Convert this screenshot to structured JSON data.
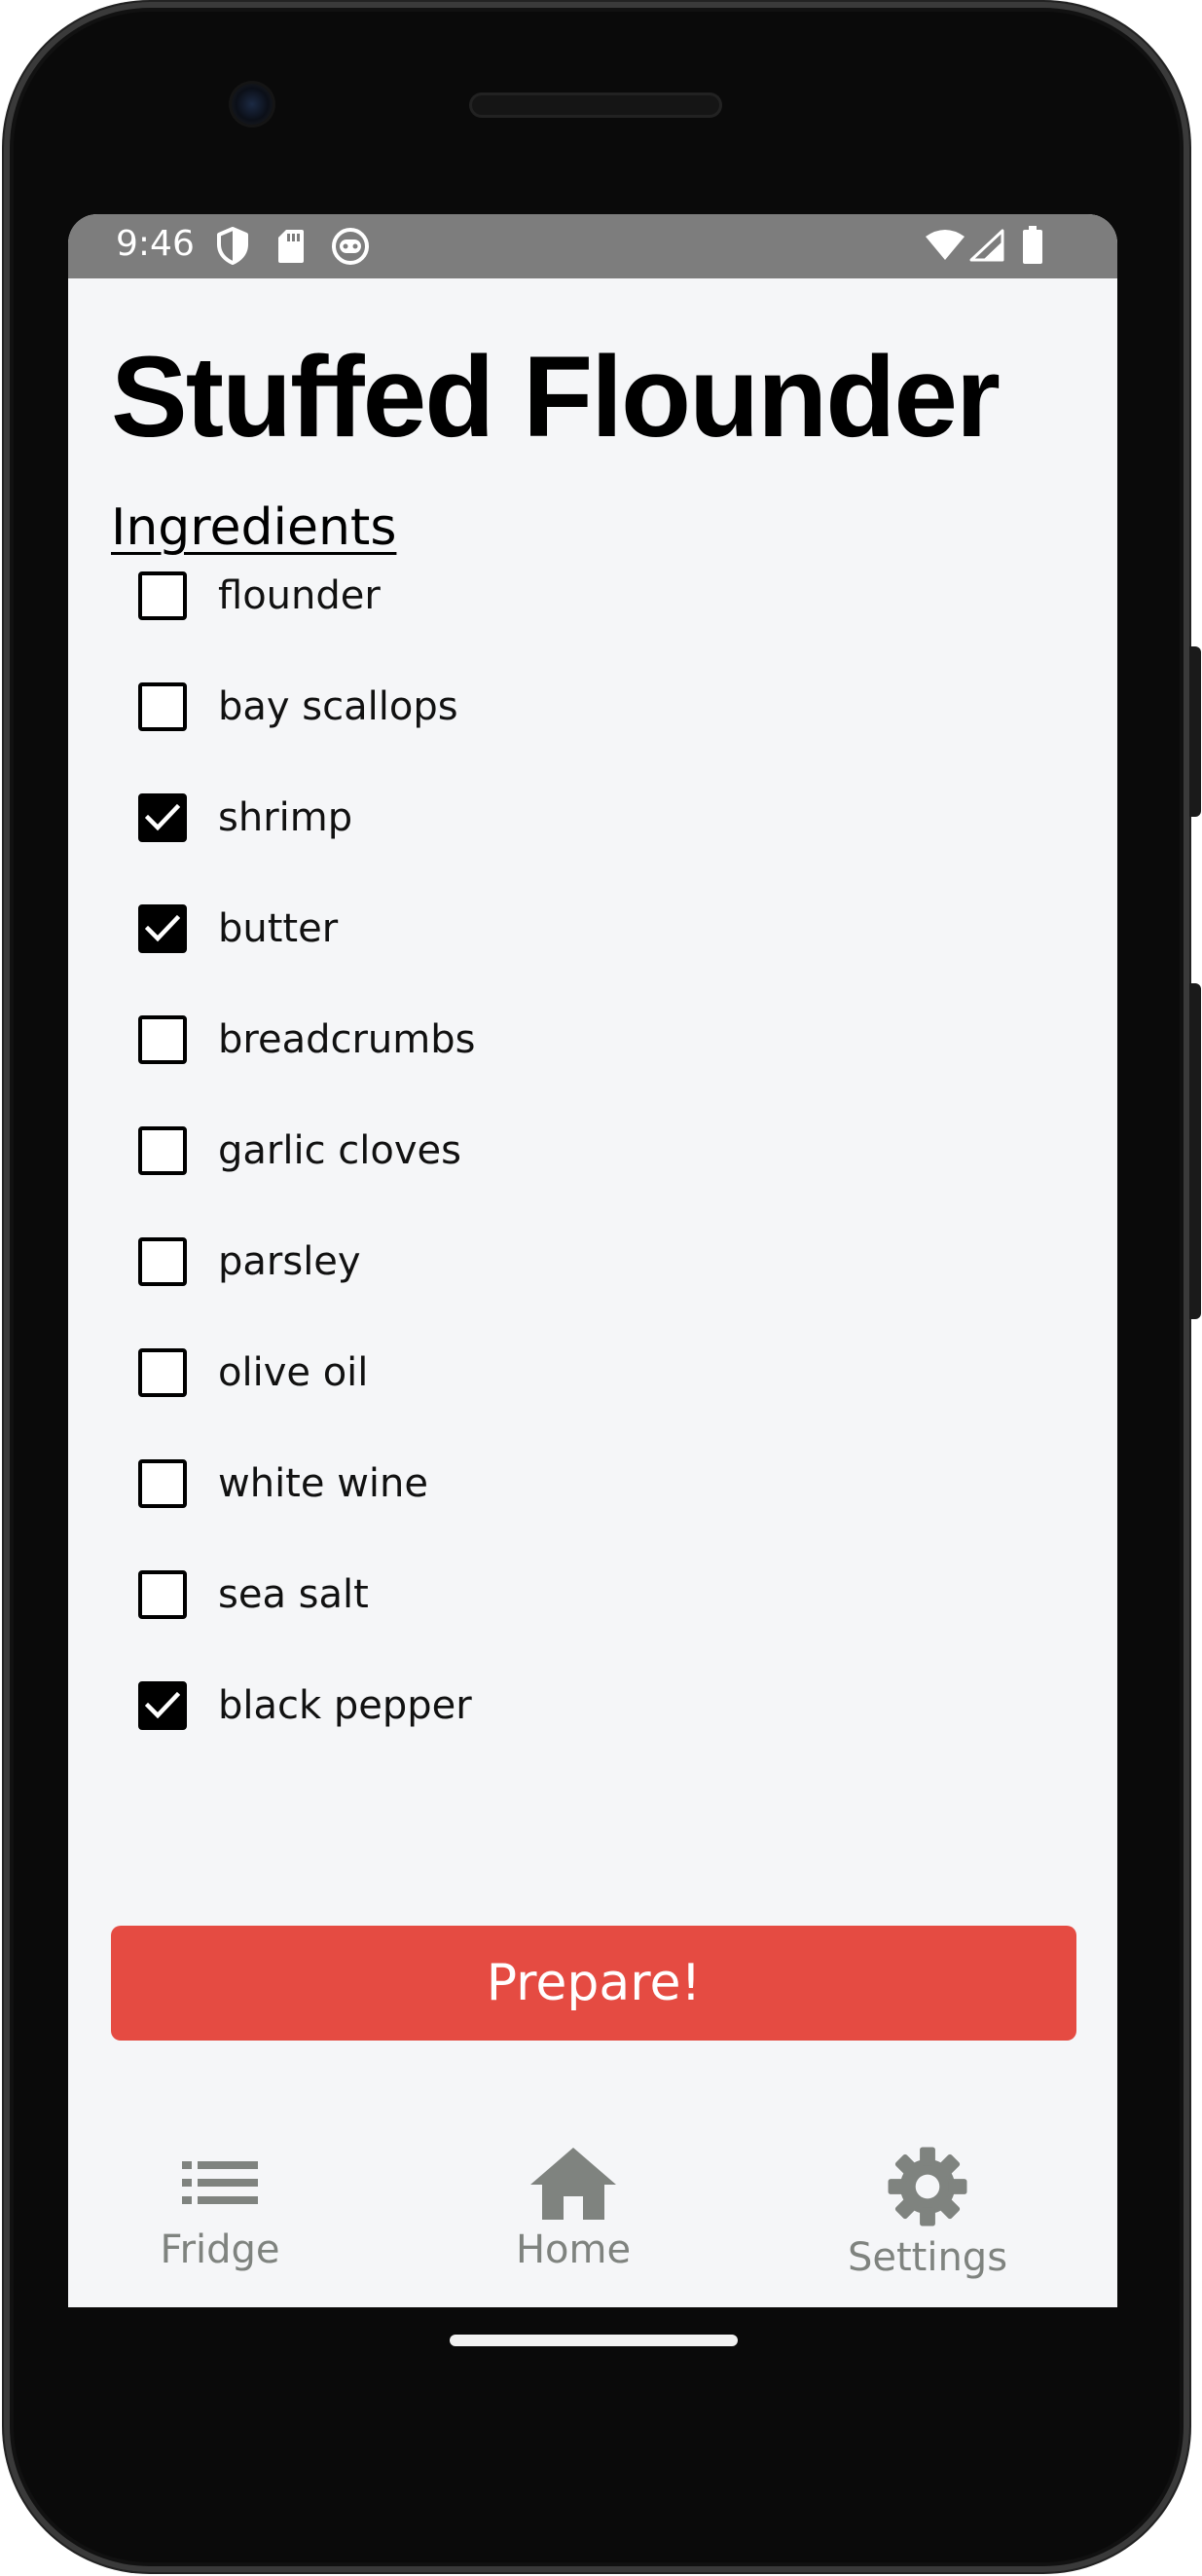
{
  "status_bar": {
    "time": "9:46",
    "left_icons": [
      "shield-icon",
      "sd-card-icon",
      "android-face-icon"
    ],
    "right_icons": [
      "wifi-icon",
      "cell-signal-icon",
      "battery-icon"
    ],
    "background": "#7d7d7d"
  },
  "recipe": {
    "title": "Stuffed Flounder",
    "section_heading": "Ingredients",
    "ingredients": [
      {
        "label": "flounder",
        "checked": false
      },
      {
        "label": "bay scallops",
        "checked": false
      },
      {
        "label": "shrimp",
        "checked": true
      },
      {
        "label": "butter",
        "checked": true
      },
      {
        "label": "breadcrumbs",
        "checked": false
      },
      {
        "label": "garlic cloves",
        "checked": false
      },
      {
        "label": "parsley",
        "checked": false
      },
      {
        "label": "olive oil",
        "checked": false
      },
      {
        "label": "white wine",
        "checked": false
      },
      {
        "label": "sea salt",
        "checked": false
      },
      {
        "label": "black pepper",
        "checked": true
      }
    ],
    "action_button": "Prepare!",
    "action_color": "#e54b42"
  },
  "bottom_nav": {
    "items": [
      {
        "label": "Fridge",
        "icon": "list-icon"
      },
      {
        "label": "Home",
        "icon": "home-icon"
      },
      {
        "label": "Settings",
        "icon": "gear-icon"
      }
    ],
    "color": "#7f837f"
  }
}
